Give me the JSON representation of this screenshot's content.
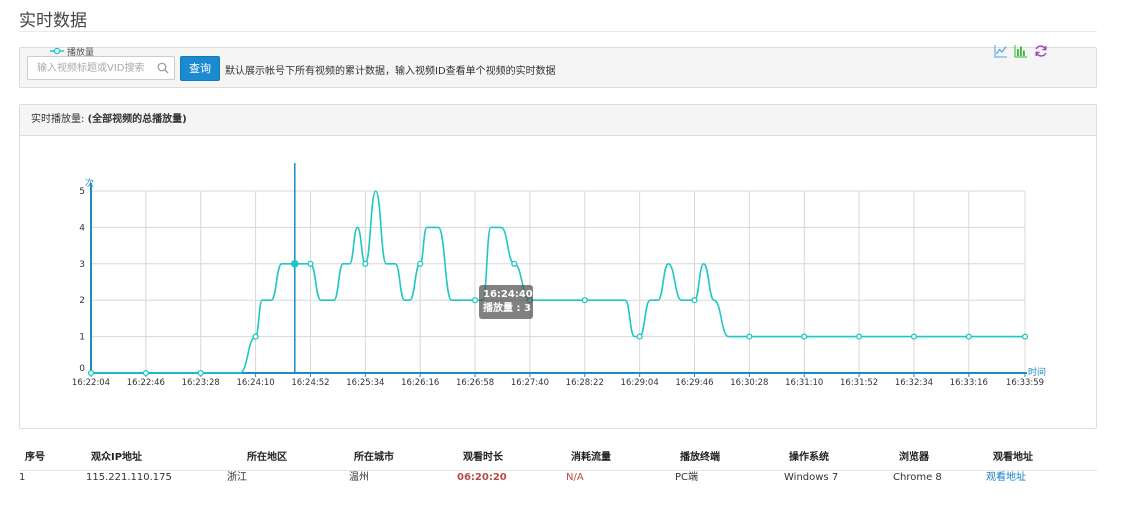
{
  "page": {
    "title": "实时数据"
  },
  "search": {
    "placeholder": "输入视频标题或VID搜索",
    "button_label": "查询",
    "hint": "默认展示帐号下所有视频的累计数据，输入视频ID查看单个视频的实时数据"
  },
  "chart_panel": {
    "header_label": "实时播放量:",
    "header_note": "(全部视频的总播放量)",
    "tools": [
      "line-chart-icon",
      "bar-chart-icon",
      "refresh-icon"
    ]
  },
  "colors": {
    "series": "#1fc7c3",
    "axis": "#1f8bc4",
    "accent_button": "#1b8bd0",
    "tool_line": "#4aa8e0",
    "tool_bar": "#35b835",
    "tool_refresh": "#9c3fb8"
  },
  "chart_data": {
    "type": "line",
    "ylabel": "次",
    "xlabel": "时间",
    "ylim": [
      0,
      5
    ],
    "yticks": [
      0,
      1,
      2,
      3,
      4,
      5
    ],
    "x_tick_labels": [
      "16:22:04",
      "16:22:46",
      "16:23:28",
      "16:24:10",
      "16:24:52",
      "16:25:34",
      "16:26:16",
      "16:26:58",
      "16:27:40",
      "16:28:22",
      "16:29:04",
      "16:29:46",
      "16:30:28",
      "16:31:10",
      "16:31:52",
      "16:32:34",
      "16:33:16",
      "16:33:59"
    ],
    "series": [
      {
        "name": "播放量",
        "points": [
          [
            "16:22:04",
            0
          ],
          [
            "16:22:46",
            0
          ],
          [
            "16:23:28",
            0
          ],
          [
            "16:23:58",
            0
          ],
          [
            "16:24:10",
            1
          ],
          [
            "16:24:15",
            2
          ],
          [
            "16:24:22",
            2
          ],
          [
            "16:24:30",
            3
          ],
          [
            "16:24:40",
            3
          ],
          [
            "16:24:52",
            3
          ],
          [
            "16:25:00",
            2
          ],
          [
            "16:25:10",
            2
          ],
          [
            "16:25:17",
            3
          ],
          [
            "16:25:22",
            3
          ],
          [
            "16:25:28",
            4
          ],
          [
            "16:25:34",
            3
          ],
          [
            "16:25:42",
            5
          ],
          [
            "16:25:50",
            3
          ],
          [
            "16:25:57",
            3
          ],
          [
            "16:26:04",
            2
          ],
          [
            "16:26:08",
            2
          ],
          [
            "16:26:16",
            3
          ],
          [
            "16:26:21",
            4
          ],
          [
            "16:26:30",
            4
          ],
          [
            "16:26:40",
            2
          ],
          [
            "16:26:58",
            2
          ],
          [
            "16:27:04",
            2
          ],
          [
            "16:27:10",
            4
          ],
          [
            "16:27:18",
            4
          ],
          [
            "16:27:28",
            3
          ],
          [
            "16:27:40",
            2
          ],
          [
            "16:28:22",
            2
          ],
          [
            "16:28:53",
            2
          ],
          [
            "16:29:00",
            1
          ],
          [
            "16:29:04",
            1
          ],
          [
            "16:29:12",
            2
          ],
          [
            "16:29:18",
            2
          ],
          [
            "16:29:26",
            3
          ],
          [
            "16:29:36",
            2
          ],
          [
            "16:29:46",
            2
          ],
          [
            "16:29:53",
            3
          ],
          [
            "16:30:01",
            2
          ],
          [
            "16:30:12",
            1
          ],
          [
            "16:30:28",
            1
          ],
          [
            "16:31:10",
            1
          ],
          [
            "16:31:52",
            1
          ],
          [
            "16:32:34",
            1
          ],
          [
            "16:33:16",
            1
          ],
          [
            "16:33:59",
            1
          ]
        ],
        "markers": [
          "16:22:04",
          "16:22:46",
          "16:23:28",
          "16:24:10",
          "16:24:40",
          "16:24:52",
          "16:25:34",
          "16:26:16",
          "16:26:58",
          "16:27:28",
          "16:27:40",
          "16:28:22",
          "16:29:04",
          "16:29:46",
          "16:30:28",
          "16:31:10",
          "16:31:52",
          "16:32:34",
          "16:33:16",
          "16:33:59"
        ]
      }
    ],
    "hover": {
      "time": "16:24:40",
      "tooltip_time": "16:24:40",
      "tooltip_value": "播放量 : 3",
      "value": 3
    },
    "legend_position": "top-left",
    "grid": true
  },
  "table": {
    "headers": [
      "序号",
      "观众IP地址",
      "所在地区",
      "所在城市",
      "观看时长",
      "消耗流量",
      "播放终端",
      "操作系统",
      "浏览器",
      "观看地址"
    ],
    "rows": [
      [
        "1",
        "115.221.110.175",
        "浙江",
        "温州",
        "06:20:20",
        "N/A",
        "PC端",
        "Windows 7",
        "Chrome 8",
        "观看地址"
      ]
    ]
  }
}
